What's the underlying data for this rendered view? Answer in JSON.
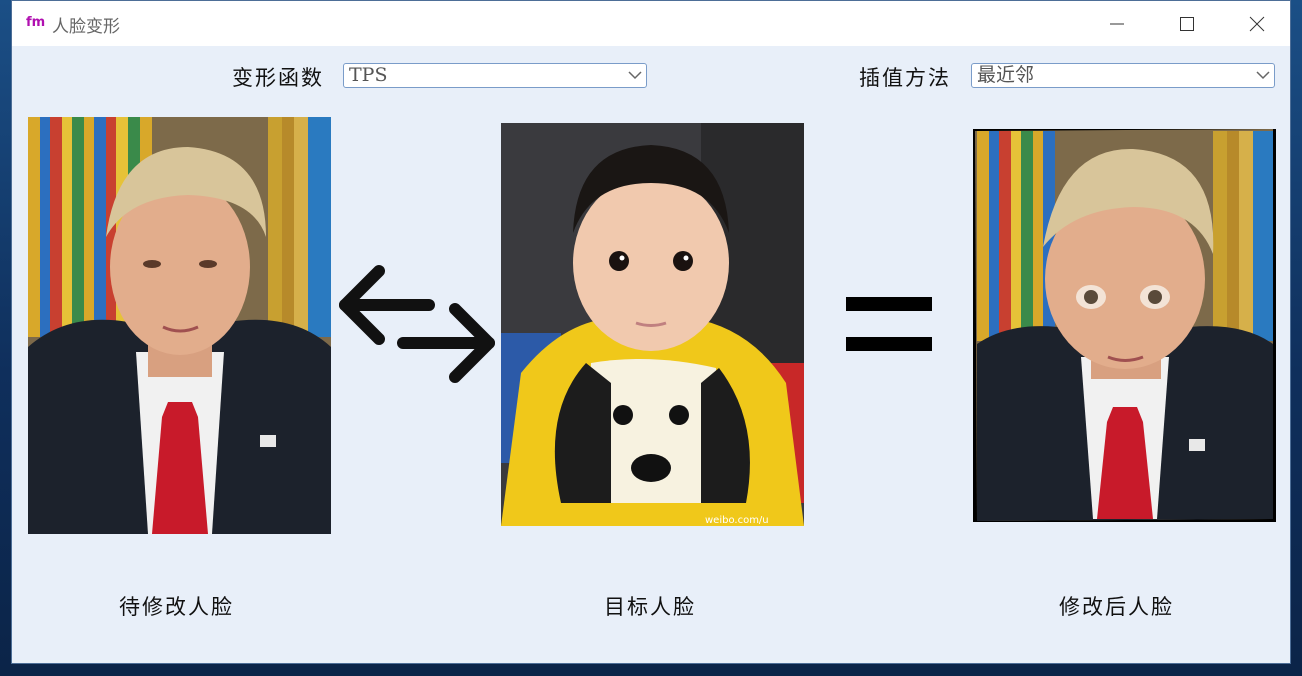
{
  "window": {
    "logo": "fm",
    "title": "人脸变形"
  },
  "controls": {
    "warp_label": "变形函数",
    "warp_value": "TPS",
    "interp_label": "插值方法",
    "interp_value": "最近邻"
  },
  "images": {
    "source_alt": "Trump portrait",
    "target_alt": "Baby in yellow sweater",
    "target_watermark": "weibo.com/u",
    "result_alt": "Warped face result"
  },
  "captions": {
    "source": "待修改人脸",
    "target": "目标人脸",
    "result": "修改后人脸"
  },
  "colors": {
    "window_bg": "#e8eff9",
    "logo": "#b010b0",
    "select_border": "#7a9cc9"
  }
}
